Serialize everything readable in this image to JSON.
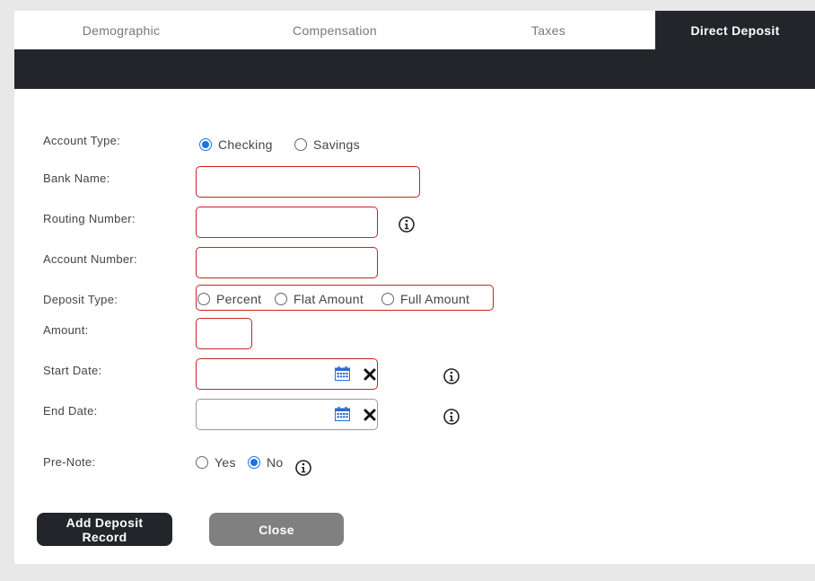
{
  "tabs": [
    {
      "label": "Demographic",
      "active": false
    },
    {
      "label": "Compensation",
      "active": false
    },
    {
      "label": "Taxes",
      "active": false
    },
    {
      "label": "Direct Deposit",
      "active": true
    }
  ],
  "form": {
    "account_type": {
      "label": "Account Type:",
      "options": [
        "Checking",
        "Savings"
      ],
      "selected": "Checking"
    },
    "bank_name": {
      "label": "Bank Name:",
      "value": ""
    },
    "routing_number": {
      "label": "Routing Number:",
      "value": ""
    },
    "account_number": {
      "label": "Account Number:",
      "value": ""
    },
    "deposit_type": {
      "label": "Deposit Type:",
      "options": [
        "Percent",
        "Flat Amount",
        "Full Amount"
      ],
      "selected": ""
    },
    "amount": {
      "label": "Amount:",
      "value": ""
    },
    "start_date": {
      "label": "Start Date:",
      "value": ""
    },
    "end_date": {
      "label": "End Date:",
      "value": ""
    },
    "pre_note": {
      "label": "Pre-Note:",
      "options": [
        "Yes",
        "No"
      ],
      "selected": "No"
    }
  },
  "buttons": {
    "add_label": "Add Deposit Record",
    "close_label": "Close"
  },
  "colors": {
    "dark": "#23252a",
    "invalid_border": "#cc2222",
    "radio_checked": "#1a73e8",
    "close_button": "#808080"
  },
  "icons": [
    "info-icon",
    "calendar-icon",
    "clear-icon"
  ]
}
